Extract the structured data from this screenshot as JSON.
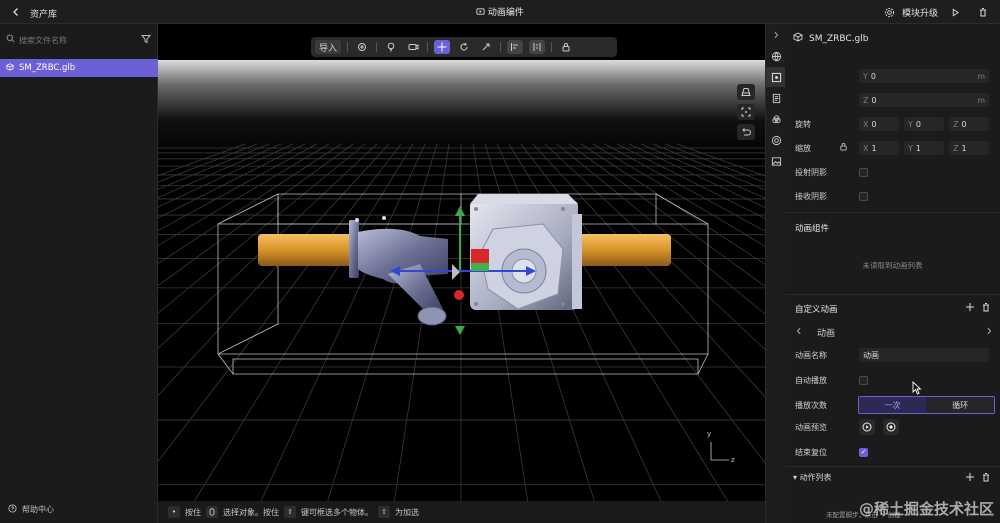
{
  "topbar": {
    "library_label": "资产库",
    "title": "动画编件",
    "upgrade_label": "模块升级"
  },
  "left": {
    "search_placeholder": "搜索文件名称",
    "asset_name": "SM_ZRBC.glb",
    "help_label": "帮助中心"
  },
  "toolbar": {
    "import_label": "导入"
  },
  "status": {
    "t1": "按住",
    "t2": "选择对象。按住",
    "t3": "键可框选多个物体。",
    "t4": "为加选"
  },
  "axis": {
    "y": "y",
    "z": "z"
  },
  "props": {
    "title": "SM_ZRBC.glb",
    "pos_y": {
      "axis": "Y",
      "value": "0",
      "unit": "m"
    },
    "pos_z": {
      "axis": "Z",
      "value": "0",
      "unit": "m"
    },
    "rotation_label": "旋转",
    "rot": [
      {
        "axis": "X",
        "value": "0"
      },
      {
        "axis": "Y",
        "value": "0"
      },
      {
        "axis": "Z",
        "value": "0"
      }
    ],
    "scale_label": "缩放",
    "scale": [
      {
        "axis": "X",
        "value": "1"
      },
      {
        "axis": "Y",
        "value": "1"
      },
      {
        "axis": "Z",
        "value": "1"
      }
    ],
    "cast_shadow_label": "投射阴影",
    "receive_shadow_label": "接收阴影",
    "anim_component_title": "动画组件",
    "anim_empty": "未读取到动画列表",
    "custom_anim_title": "自定义动画",
    "anim_name_nav": "动画",
    "anim_name_label": "动画名称",
    "anim_name_value": "动画",
    "autoplay_label": "自动播放",
    "play_count_label": "播放次数",
    "play_once": "一次",
    "play_loop": "循环",
    "preview_label": "动画预览",
    "reset_label": "结束复位",
    "action_list_label": "动作列表"
  },
  "watermark": "@稀土掘金技术社区",
  "watermark_sub": "未配置脚步，点击 + 创建",
  "colors": {
    "accent": "#6b60d6",
    "pipe": "#e0a030"
  }
}
